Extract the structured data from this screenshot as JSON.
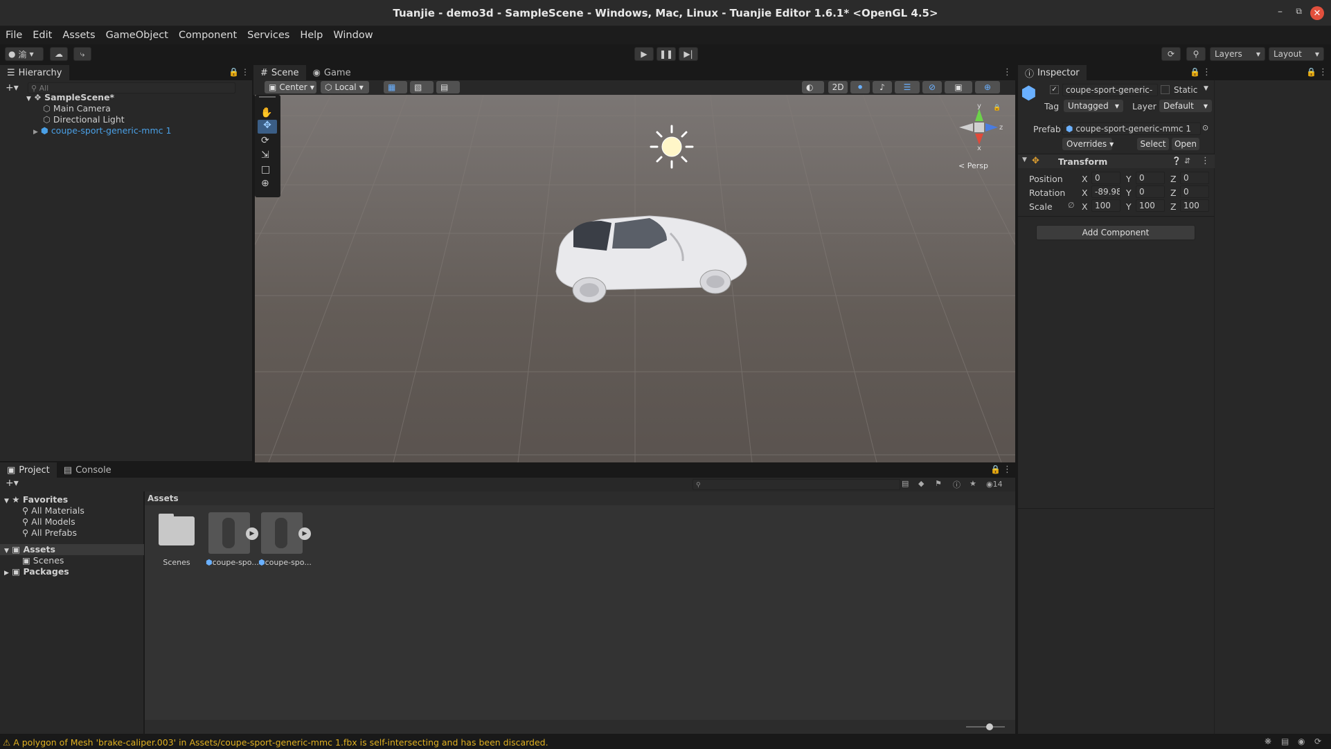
{
  "window": {
    "title": "Tuanjie - demo3d - SampleScene - Windows, Mac, Linux - Tuanjie Editor 1.6.1* <OpenGL 4.5>"
  },
  "menu": [
    "File",
    "Edit",
    "Assets",
    "GameObject",
    "Component",
    "Services",
    "Help",
    "Window"
  ],
  "toolbar": {
    "account_label": "渝",
    "layers_label": "Layers",
    "layout_label": "Layout"
  },
  "hierarchy": {
    "tab": "Hierarchy",
    "search_placeholder": "All",
    "scene": "SampleScene*",
    "items": [
      "Main Camera",
      "Directional Light",
      "coupe-sport-generic-mmc 1"
    ]
  },
  "scene_view": {
    "tabs": [
      "Scene",
      "Game"
    ],
    "pivot_label": "Center",
    "space_label": "Local",
    "mode_2d": "2D",
    "gizmo_labels": {
      "y": "y",
      "z": "z",
      "x": "x"
    },
    "persp_label": "< Persp"
  },
  "inspector": {
    "tab": "Inspector",
    "object_name": "coupe-sport-generic-",
    "static_label": "Static",
    "tag_label": "Tag",
    "tag_value": "Untagged",
    "layer_label": "Layer",
    "layer_value": "Default",
    "prefab_label": "Prefab",
    "prefab_value": "coupe-sport-generic-mmc 1",
    "overrides_label": "Overrides",
    "select_label": "Select",
    "open_label": "Open",
    "transform_title": "Transform",
    "position_label": "Position",
    "rotation_label": "Rotation",
    "scale_label": "Scale",
    "axis_x": "X",
    "axis_y": "Y",
    "axis_z": "Z",
    "position": {
      "x": "0",
      "y": "0",
      "z": "0"
    },
    "rotation": {
      "x": "-89.98",
      "y": "0",
      "z": "0"
    },
    "scale": {
      "x": "100",
      "y": "100",
      "z": "100"
    },
    "add_component_label": "Add Component"
  },
  "project": {
    "tabs": [
      "Project",
      "Console"
    ],
    "favorites_label": "Favorites",
    "favorites": [
      "All Materials",
      "All Models",
      "All Prefabs"
    ],
    "assets_label": "Assets",
    "scenes_label": "Scenes",
    "packages_label": "Packages",
    "breadcrumb": "Assets",
    "visible_count": "14",
    "grid_items": [
      "Scenes",
      "coupe-spo...",
      "coupe-spo..."
    ]
  },
  "status": {
    "message": "A polygon of Mesh 'brake-caliper.003' in Assets/coupe-sport-generic-mmc 1.fbx is self-intersecting and has been discarded."
  },
  "colors": {
    "accent": "#4aa0e6",
    "warning": "#e0b020",
    "selected_row": "#4d4d4d"
  }
}
